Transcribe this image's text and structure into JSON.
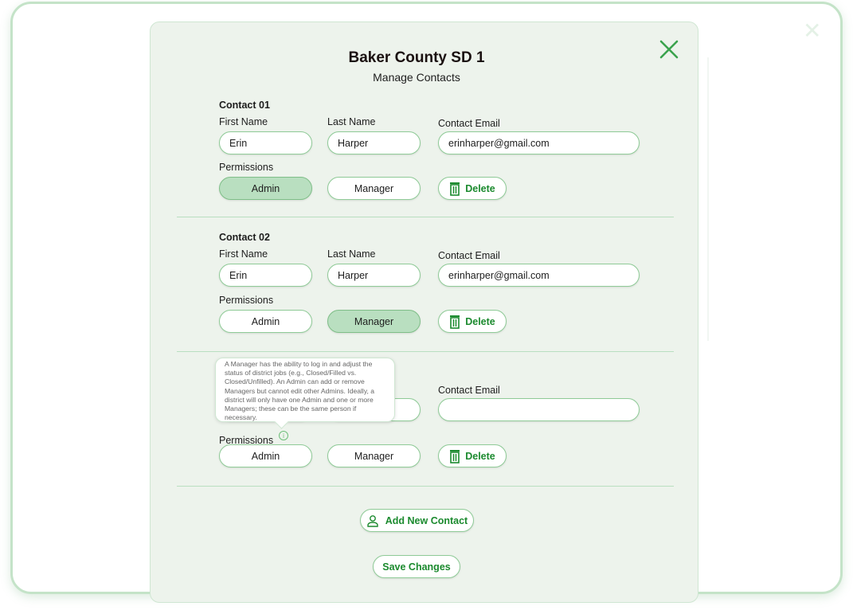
{
  "modal": {
    "title": "Baker County SD 1",
    "subtitle": "Manage Contacts"
  },
  "labels": {
    "first_name": "First Name",
    "last_name": "Last Name",
    "email": "Contact Email",
    "permissions": "Permissions",
    "admin": "Admin",
    "manager": "Manager",
    "delete": "Delete"
  },
  "contacts": [
    {
      "title": "Contact 01",
      "first_name": "Erin",
      "last_name": "Harper",
      "email": "erinharper@gmail.com",
      "permission": "Admin"
    },
    {
      "title": "Contact 02",
      "first_name": "Erin",
      "last_name": "Harper",
      "email": "erinharper@gmail.com",
      "permission": "Manager"
    },
    {
      "title": "",
      "first_name": "",
      "last_name": "",
      "email": "",
      "permission": ""
    }
  ],
  "tooltip": "A Manager has the ability to log in and adjust the status of district jobs (e.g., Closed/Filled vs. Closed/Unfilled). An Admin can add or remove Managers but cannot edit other Admins. Ideally, a district will only have one Admin and one or more Managers; these can be the same person if necessary.",
  "actions": {
    "add_contact": "Add New Contact",
    "save": "Save Changes"
  },
  "colors": {
    "accent": "#1b8a2e",
    "selected": "#b9dfc0",
    "modal_bg": "#edf3ec"
  }
}
